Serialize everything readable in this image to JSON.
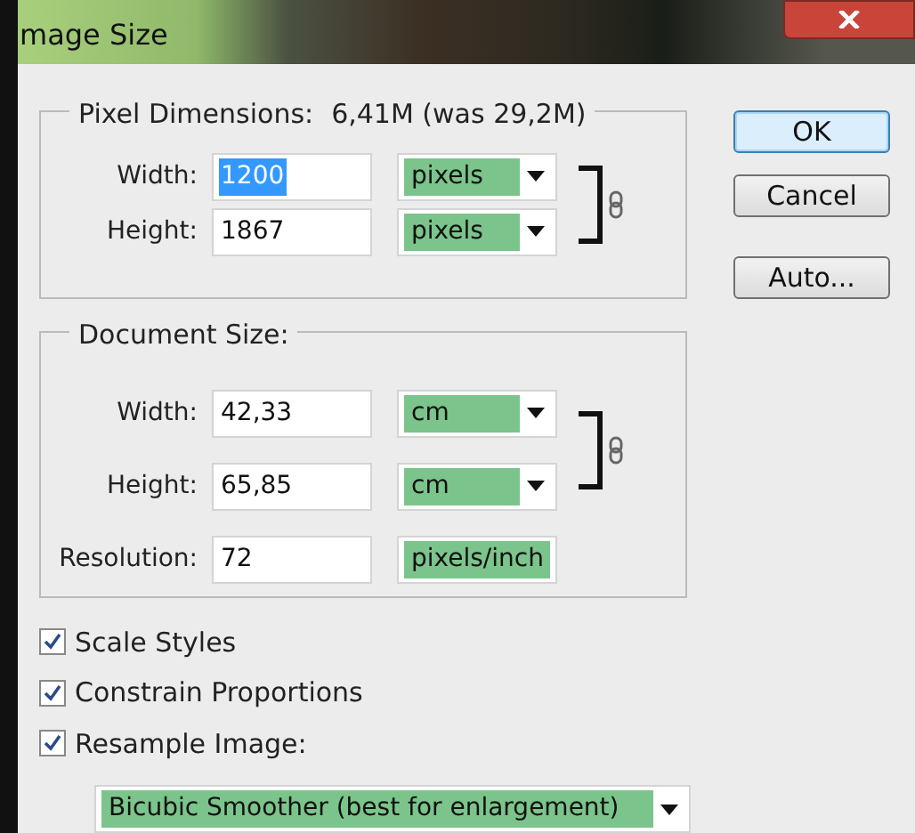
{
  "window": {
    "title": "mage Size"
  },
  "pixel_dimensions": {
    "label": "Pixel Dimensions:",
    "value": "6,41M (was 29,2M)",
    "linked": true,
    "rows": [
      {
        "label": "Width:",
        "value": "1200",
        "text_selected": true,
        "unit": "pixels"
      },
      {
        "label": "Height:",
        "value": "1867",
        "text_selected": false,
        "unit": "pixels"
      }
    ]
  },
  "document_size": {
    "label": "Document Size:",
    "linked": true,
    "rows": [
      {
        "label": "Width:",
        "value": "42,33",
        "unit": "cm"
      },
      {
        "label": "Height:",
        "value": "65,85",
        "unit": "cm"
      },
      {
        "label": "Resolution:",
        "value": "72",
        "unit": "pixels/inch"
      }
    ]
  },
  "options": [
    {
      "label": "Scale Styles",
      "checked": true
    },
    {
      "label": "Constrain Proportions",
      "checked": true
    },
    {
      "label": "Resample Image:",
      "checked": true
    }
  ],
  "resample_method": "Bicubic Smoother (best for enlargement)",
  "buttons": [
    {
      "label": "OK",
      "default": true
    },
    {
      "label": "Cancel",
      "default": false
    },
    {
      "label": "Auto...",
      "default": false
    }
  ]
}
